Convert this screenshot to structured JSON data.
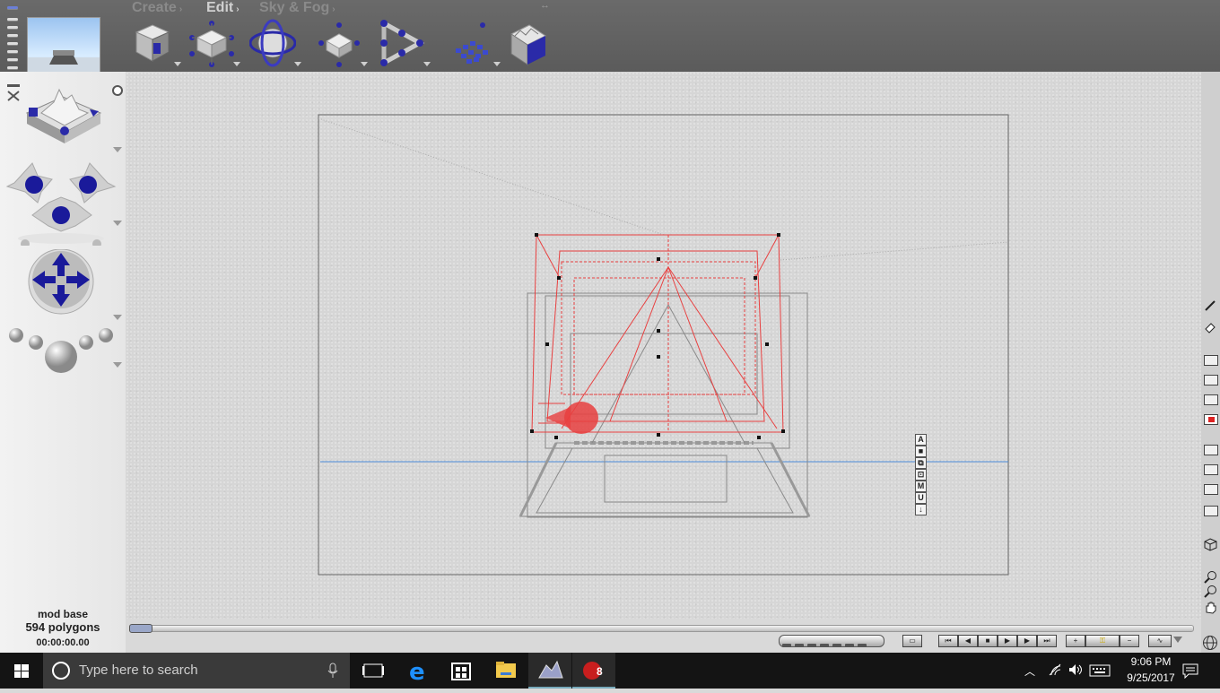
{
  "app": {
    "menus": [
      {
        "label": "Create",
        "arrow": "›"
      },
      {
        "label": "Edit",
        "arrow": "›"
      },
      {
        "label": "Sky & Fog",
        "arrow": "›"
      }
    ],
    "resize_hint": "↔"
  },
  "toolbar": {
    "tools": [
      "cube-tool-icon",
      "lattice-tool-icon",
      "sphere-orbit-icon",
      "transform-node-icon",
      "playback-path-icon",
      "particle-grid-icon",
      "terrain-block-icon"
    ]
  },
  "left_panel": {
    "tools": [
      "terrain-preview-icon",
      "rotate-arrows-icon",
      "move-sphere-icon",
      "scale-spheres-icon"
    ]
  },
  "status": {
    "object_name": "mod base",
    "polygons": "594 polygons",
    "time": "00:00:00.00"
  },
  "viewport_buttons": [
    "A",
    "■",
    "⧉",
    "⊡",
    "M",
    "U",
    "↓"
  ],
  "colors": {
    "viewport_bg": "#d6d6d6",
    "selection": "#e84040",
    "wireframe": "#8a8a8a",
    "horizon": "#4a8ad8",
    "accent_blue": "#2a2aa8"
  },
  "taskbar": {
    "search_placeholder": "Type here to search",
    "time": "9:06 PM",
    "date": "9/25/2017",
    "psp_badge": "8"
  }
}
